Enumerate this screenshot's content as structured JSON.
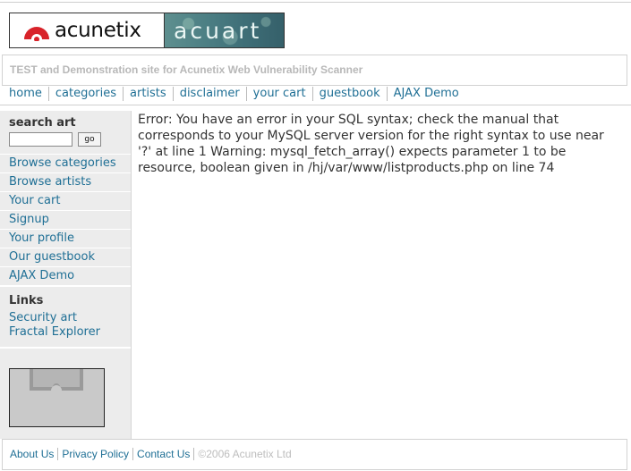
{
  "logo": {
    "brand": "acunetix",
    "site": "acuart"
  },
  "tagline": "TEST and Demonstration site for Acunetix Web Vulnerability Scanner",
  "topnav": [
    "home",
    "categories",
    "artists",
    "disclaimer",
    "your cart",
    "guestbook",
    "AJAX Demo"
  ],
  "search": {
    "title": "search art",
    "value": "",
    "button": "go"
  },
  "side_menu": [
    "Browse categories",
    "Browse artists",
    "Your cart",
    "Signup",
    "Your profile",
    "Our guestbook",
    "AJAX Demo"
  ],
  "links": {
    "title": "Links",
    "items": [
      "Security art",
      "Fractal Explorer"
    ]
  },
  "main": {
    "error_text": "Error: You have an error in your SQL syntax; check the manual that corresponds to your MySQL server version for the right syntax to use near '?' at line 1 Warning: mysql_fetch_array() expects parameter 1 to be resource, boolean given in /hj/var/www/listproducts.php on line 74"
  },
  "footer": {
    "links": [
      "About Us",
      "Privacy Policy",
      "Contact Us"
    ],
    "copyright": "©2006 Acunetix Ltd"
  },
  "colors": {
    "link": "#1f6f95",
    "sidebar_bg": "#ececec",
    "logo_red": "#d8232a"
  }
}
